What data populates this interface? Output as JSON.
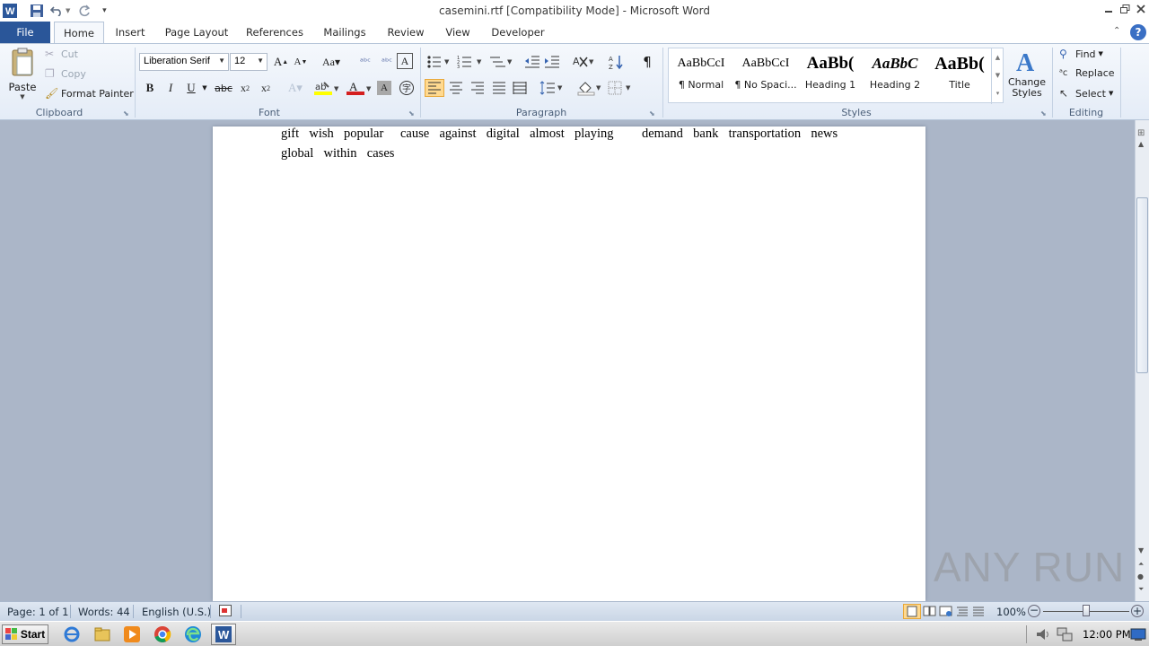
{
  "window": {
    "title": "casemini.rtf [Compatibility Mode]  -  Microsoft Word"
  },
  "tabs": [
    "File",
    "Home",
    "Insert",
    "Page Layout",
    "References",
    "Mailings",
    "Review",
    "View",
    "Developer"
  ],
  "clipboard": {
    "paste": "Paste",
    "cut": "Cut",
    "copy": "Copy",
    "format_painter": "Format Painter",
    "label": "Clipboard"
  },
  "font": {
    "name": "Liberation Serif",
    "size": "12",
    "label": "Font"
  },
  "paragraph": {
    "label": "Paragraph"
  },
  "styles": {
    "items": [
      {
        "sample": "AaBbCcI",
        "name": "¶ Normal"
      },
      {
        "sample": "AaBbCcI",
        "name": "¶ No Spaci..."
      },
      {
        "sample": "AaBb(",
        "name": "Heading 1"
      },
      {
        "sample": "AaBbC",
        "name": "Heading 2"
      },
      {
        "sample": "AaBb(",
        "name": "Title"
      }
    ],
    "change_styles": "Change Styles",
    "label": "Styles"
  },
  "editing": {
    "find": "Find",
    "replace": "Replace",
    "select": "Select",
    "label": "Editing"
  },
  "document": {
    "line1_a": "gift  wish  popular",
    "line1_b": "cause  against  digital  almost  playing",
    "line1_c": "demand  bank  transportation  news",
    "line2": "global  within  cases"
  },
  "status": {
    "page": "Page: 1 of 1",
    "words": "Words: 44",
    "language": "English (U.S.)",
    "zoom": "100%"
  },
  "taskbar": {
    "start": "Start",
    "time": "12:00 PM"
  },
  "watermark": "ANY RUN"
}
